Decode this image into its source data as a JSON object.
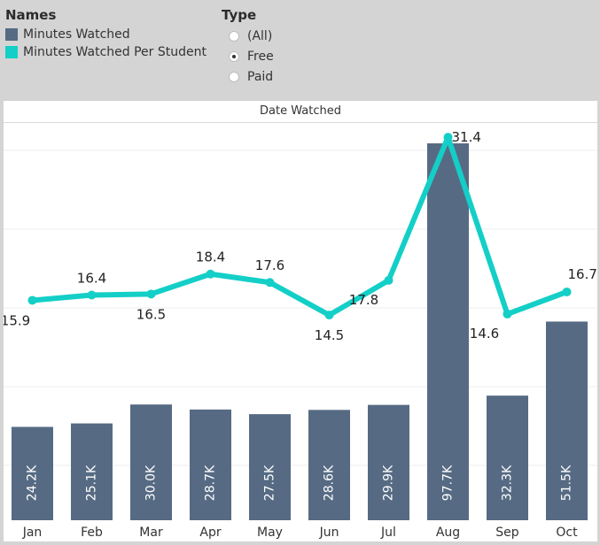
{
  "legend": {
    "names_title": "Names",
    "items": [
      {
        "label": "Minutes Watched",
        "color": "#566b83"
      },
      {
        "label": "Minutes Watched Per Student",
        "color": "#13cfc7"
      }
    ]
  },
  "filter": {
    "title": "Type",
    "options": [
      {
        "label": "(All)",
        "selected": false
      },
      {
        "label": "Free",
        "selected": true
      },
      {
        "label": "Paid",
        "selected": false
      }
    ]
  },
  "chart_data": {
    "type": "bar",
    "title": "Date Watched",
    "categories": [
      "Jan",
      "Feb",
      "Mar",
      "Apr",
      "May",
      "Jun",
      "Jul",
      "Aug",
      "Sep",
      "Oct"
    ],
    "series": [
      {
        "name": "Minutes Watched",
        "type": "bar",
        "values": [
          24200,
          25100,
          30000,
          28700,
          27500,
          28600,
          29900,
          97700,
          32300,
          51500
        ],
        "labels": [
          "24.2K",
          "25.1K",
          "30.0K",
          "28.7K",
          "27.5K",
          "28.6K",
          "29.9K",
          "97.7K",
          "32.3K",
          "51.5K"
        ],
        "color": "#566b83",
        "ylim": [
          0,
          100000
        ]
      },
      {
        "name": "Minutes Watched Per Student",
        "type": "line",
        "values": [
          15.9,
          16.4,
          16.5,
          18.4,
          17.6,
          14.5,
          17.8,
          31.4,
          14.6,
          16.7
        ],
        "labels": [
          "15.9",
          "16.4",
          "16.5",
          "18.4",
          "17.6",
          "14.5",
          "17.8",
          "31.4",
          "14.6",
          "16.7"
        ],
        "color": "#13cfc7",
        "ylim": [
          -5,
          32
        ]
      }
    ],
    "grid": true
  }
}
